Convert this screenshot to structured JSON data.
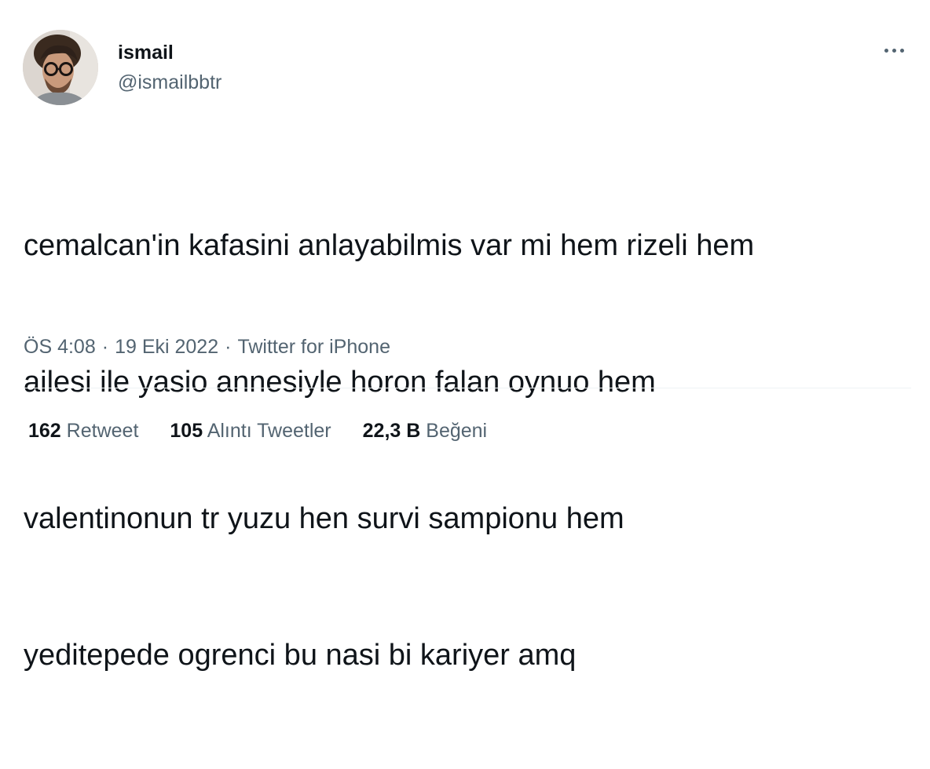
{
  "user": {
    "display_name": "ismail",
    "handle": "@ismailbbtr"
  },
  "tweet": {
    "text_lines": [
      "cemalcan'in kafasini anlayabilmis var mi hem rizeli hem",
      "ailesi ile yasio annesiyle horon falan oynuo hem",
      "valentinonun tr yuzu hen survi sampionu hem",
      "yeditepede ogrenci bu nasi bi kariyer amq"
    ],
    "time": "ÖS 4:08",
    "date": "19 Eki 2022",
    "source": "Twitter for iPhone",
    "separator": "·"
  },
  "stats": [
    {
      "value": "162",
      "label": "Retweet"
    },
    {
      "value": "105",
      "label": "Alıntı Tweetler"
    },
    {
      "value": "22,3 B",
      "label": "Beğeni"
    }
  ],
  "icons": {
    "more": "more-horizontal-icon"
  },
  "colors": {
    "text_primary": "#0f1419",
    "text_secondary": "#536471",
    "divider": "#eff3f4",
    "background": "#ffffff"
  }
}
